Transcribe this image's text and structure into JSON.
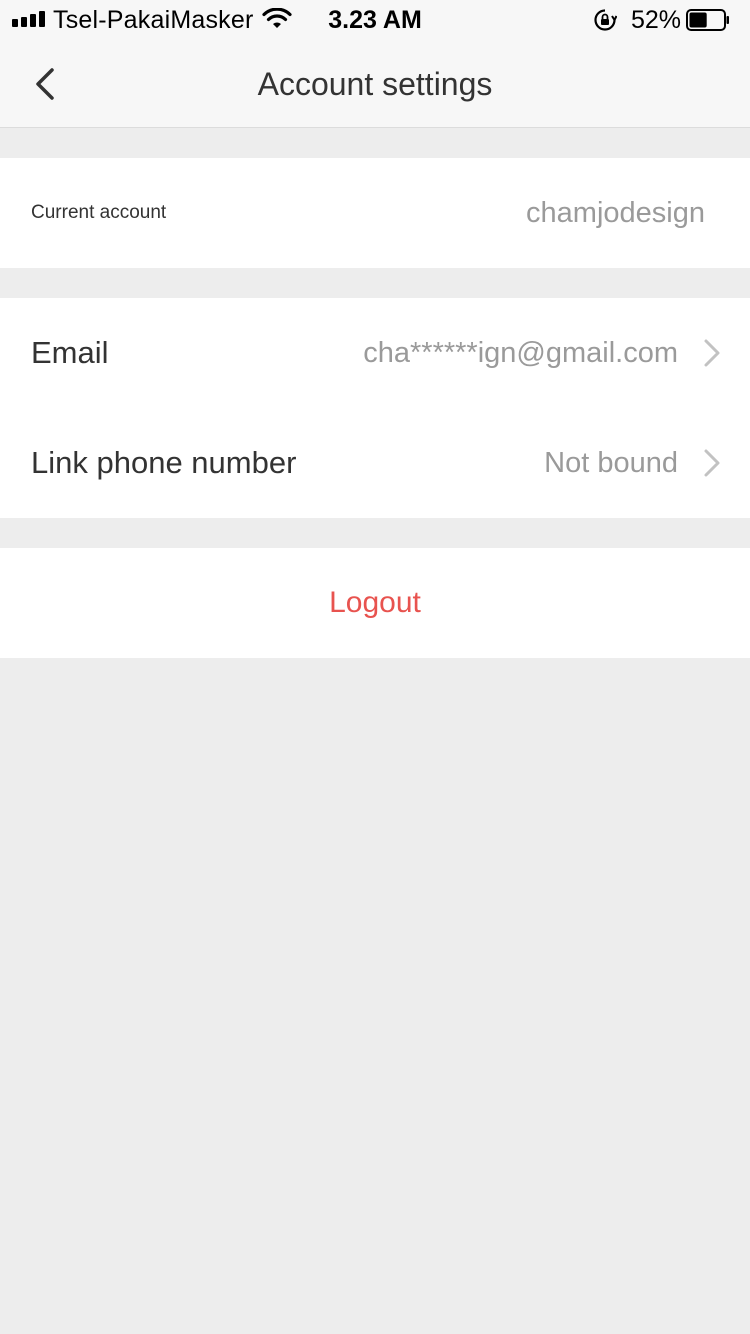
{
  "status_bar": {
    "carrier": "Tsel-PakaiMasker",
    "time": "3.23 AM",
    "battery": "52%",
    "battery_level": 0.52
  },
  "header": {
    "title": "Account settings"
  },
  "account": {
    "label": "Current account",
    "value": "chamjodesign"
  },
  "settings": {
    "email_label": "Email",
    "email_value": "cha******ign@gmail.com",
    "phone_label": "Link phone number",
    "phone_value": "Not bound"
  },
  "actions": {
    "logout": "Logout"
  },
  "colors": {
    "accent_danger": "#e8534f",
    "background": "#ededed",
    "secondary_text": "#9a9a9a"
  }
}
